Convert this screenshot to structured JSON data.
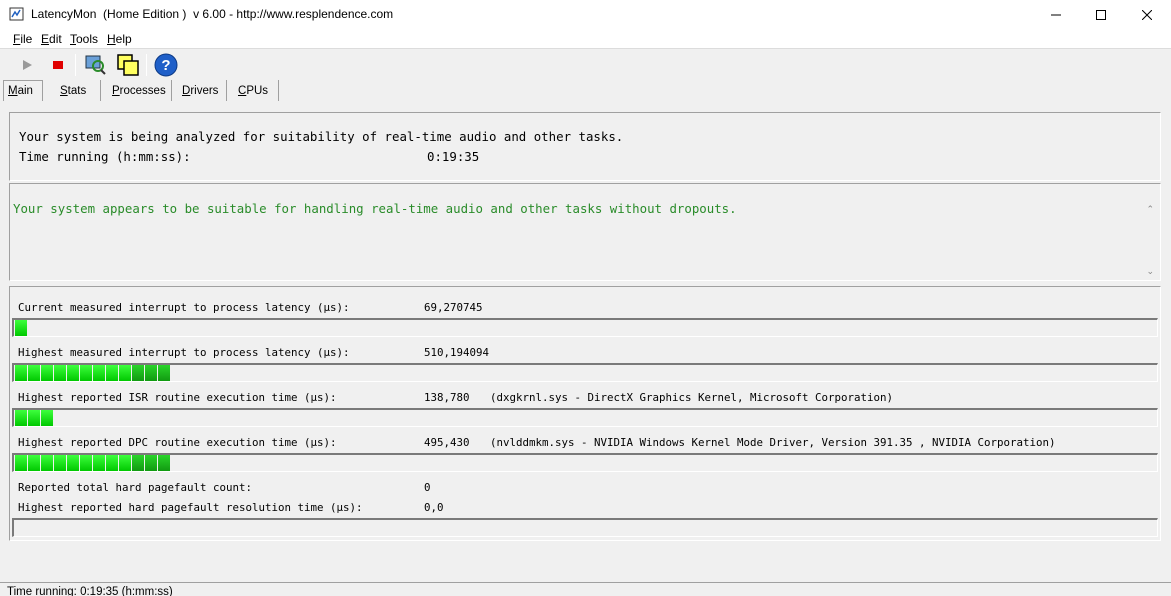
{
  "window": {
    "title": "LatencyMon  (Home Edition )  v 6.00 - http://www.resplendence.com"
  },
  "menu": [
    {
      "underline": "F",
      "rest": "ile"
    },
    {
      "underline": "E",
      "rest": "dit"
    },
    {
      "underline": "T",
      "rest": "ools"
    },
    {
      "underline": "H",
      "rest": "elp"
    }
  ],
  "toolbar": {
    "icons": [
      "play-icon",
      "stop-icon",
      "analyze-icon",
      "windows-icon",
      "help-icon"
    ]
  },
  "tabs": [
    {
      "underline": "M",
      "rest": "ain"
    },
    {
      "underline": "S",
      "rest": "tats"
    },
    {
      "underline": "P",
      "rest": "rocesses"
    },
    {
      "underline": "D",
      "rest": "rivers"
    },
    {
      "underline": "C",
      "rest": "PUs"
    }
  ],
  "summary": {
    "line1": "Your system is being analyzed for suitability of real-time audio and other tasks.",
    "time_label": "Time running (h:mm:ss):",
    "time_value": "0:19:35"
  },
  "verdict": {
    "message": "Your system appears to be suitable for handling real-time audio and other tasks without dropouts.",
    "color": "#2a8c2a"
  },
  "metrics": {
    "current_latency_label": "Current measured interrupt to process latency (µs):",
    "current_latency_value": "69,270745",
    "current_latency_level": 1,
    "highest_latency_label": "Highest measured interrupt to process latency (µs):",
    "highest_latency_value": "510,194094",
    "highest_latency_level": 12,
    "isr_label": "Highest reported ISR routine execution time (µs):",
    "isr_value": "138,780",
    "isr_detail": "(dxgkrnl.sys - DirectX Graphics Kernel, Microsoft Corporation)",
    "isr_level": 3,
    "dpc_label": "Highest reported DPC routine execution time (µs):",
    "dpc_value": "495,430",
    "dpc_detail": "(nvlddmkm.sys - NVIDIA Windows Kernel Mode Driver, Version 391.35 , NVIDIA Corporation)",
    "dpc_level": 12,
    "pagefault_count_label": "Reported total hard pagefault count:",
    "pagefault_count_value": "0",
    "pagefault_time_label": "Highest reported hard pagefault resolution time (µs):",
    "pagefault_time_value": "0,0",
    "pagefault_time_level": 0
  },
  "status": {
    "text": "Time running: 0:19:35  (h:mm:ss)"
  }
}
